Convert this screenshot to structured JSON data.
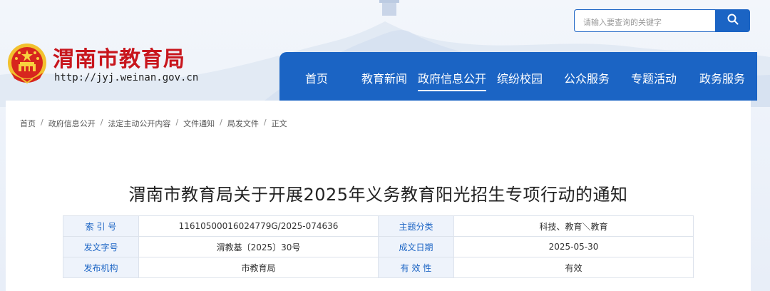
{
  "site": {
    "name": "渭南市教育局",
    "url": "http://jyj.weinan.gov.cn"
  },
  "search": {
    "placeholder": "请输入要查询的关键字",
    "icon": "search-icon"
  },
  "nav": {
    "items": [
      {
        "label": "首页"
      },
      {
        "label": "教育新闻"
      },
      {
        "label": "政府信息公开"
      },
      {
        "label": "缤纷校园"
      },
      {
        "label": "公众服务"
      },
      {
        "label": "专题活动"
      },
      {
        "label": "政务服务"
      }
    ],
    "active_index": 2
  },
  "breadcrumb": [
    "首页",
    "政府信息公开",
    "法定主动公开内容",
    "文件通知",
    "局发文件",
    "正文"
  ],
  "article": {
    "title": "渭南市教育局关于开展2025年义务教育阳光招生专项行动的通知"
  },
  "meta_table": [
    {
      "l1": "索 引 号",
      "v1": "11610500016024779G/2025-074636",
      "l2": "主题分类",
      "v2": "科技、教育＼教育"
    },
    {
      "l1": "发文字号",
      "v1": "渭教基〔2025〕30号",
      "l2": "成文日期",
      "v2": "2025-05-30"
    },
    {
      "l1": "发布机构",
      "v1": "市教育局",
      "l2": "有 效 性",
      "v2": "有效"
    }
  ],
  "colors": {
    "primary": "#1b64c4",
    "brand_red": "#c8161d"
  }
}
